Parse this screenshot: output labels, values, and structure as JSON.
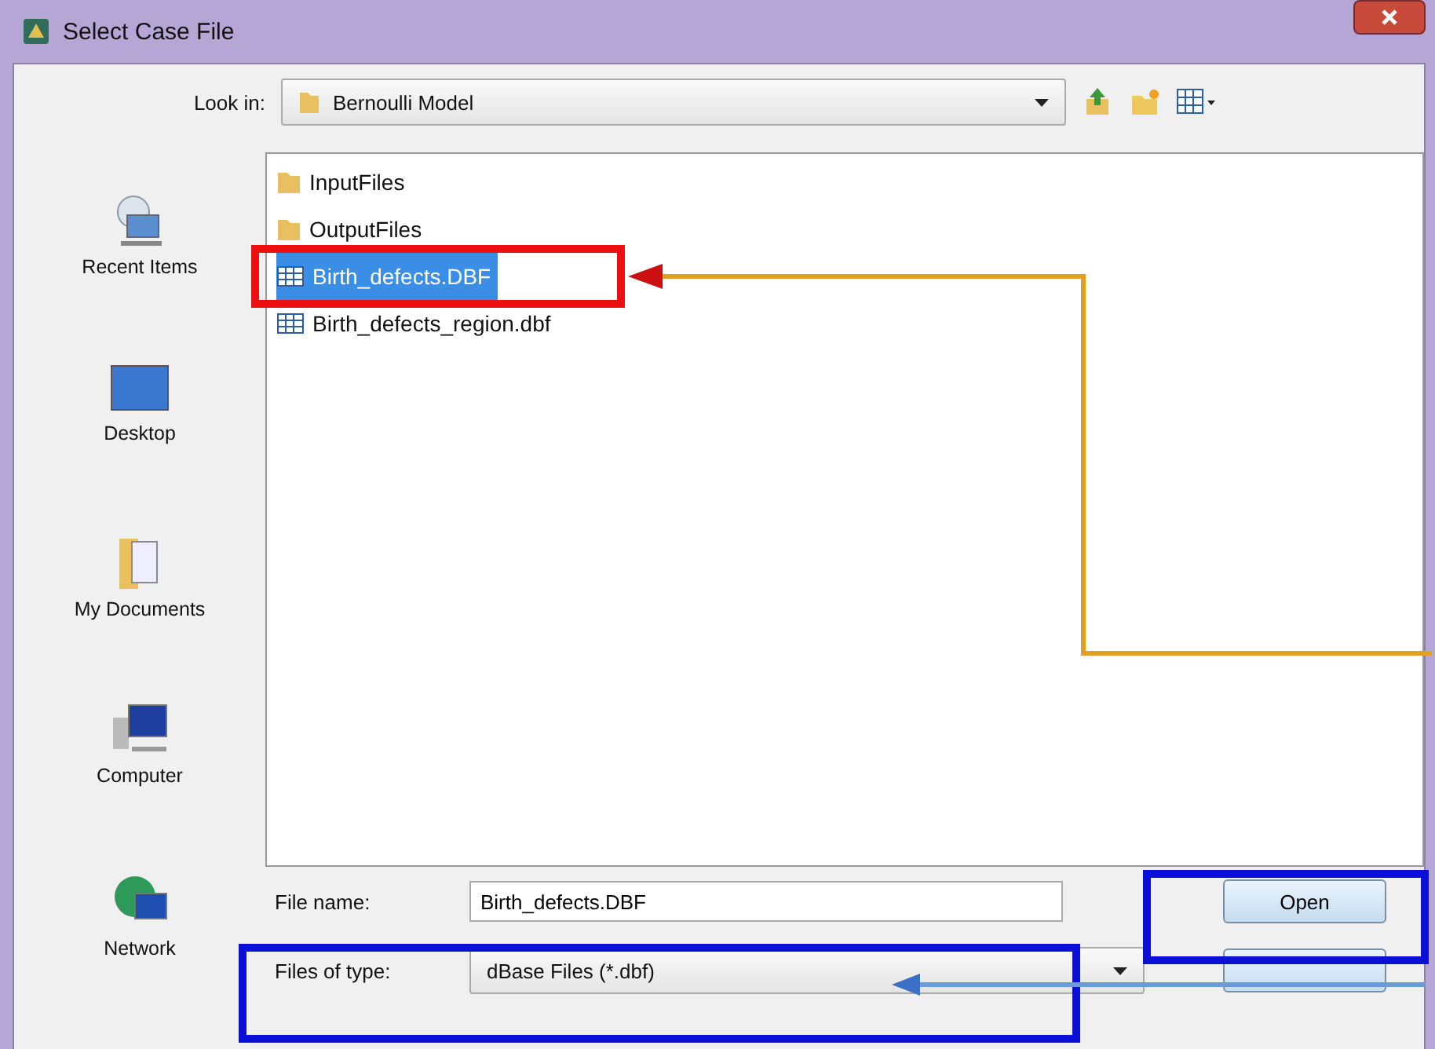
{
  "window": {
    "title": "Select Case File"
  },
  "look_in": {
    "label": "Look in:",
    "value": "Bernoulli Model"
  },
  "places": [
    {
      "label": "Recent Items",
      "kind": "recent"
    },
    {
      "label": "Desktop",
      "kind": "desktop"
    },
    {
      "label": "My Documents",
      "kind": "documents"
    },
    {
      "label": "Computer",
      "kind": "computer"
    },
    {
      "label": "Network",
      "kind": "network"
    }
  ],
  "files": [
    {
      "name": "InputFiles",
      "kind": "folder",
      "selected": false
    },
    {
      "name": "OutputFiles",
      "kind": "folder",
      "selected": false
    },
    {
      "name": "Birth_defects.DBF",
      "kind": "table",
      "selected": true
    },
    {
      "name": "Birth_defects_region.dbf",
      "kind": "table",
      "selected": false
    }
  ],
  "file_name": {
    "label": "File name:",
    "value": "Birth_defects.DBF"
  },
  "file_type": {
    "label": "Files of type:",
    "value": "dBase Files (*.dbf)"
  },
  "buttons": [
    {
      "label": "Open"
    }
  ]
}
